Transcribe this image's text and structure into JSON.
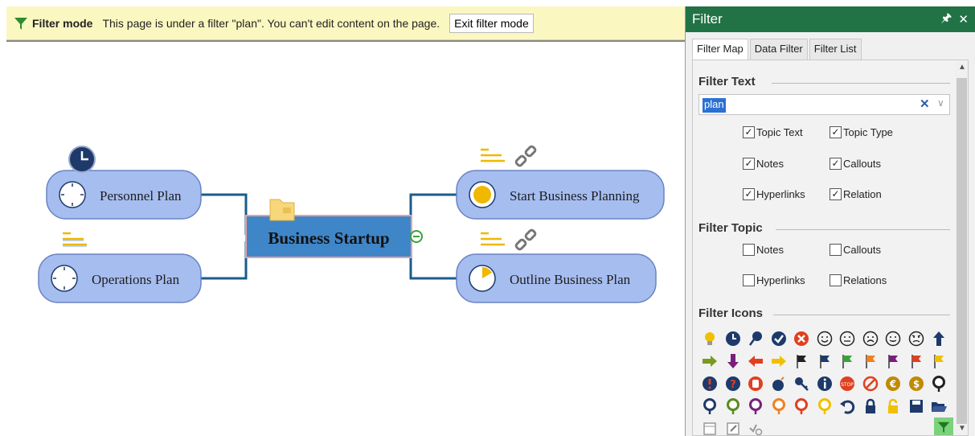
{
  "filterbar": {
    "title": "Filter mode",
    "message": "This page is under a filter \"plan\". You can't edit content on the page.",
    "exit_label": "Exit filter mode"
  },
  "mindmap": {
    "central": "Business Startup",
    "topics": {
      "personnel": "Personnel Plan",
      "operations": "Operations Plan",
      "start": "Start Business Planning",
      "outline": "Outline Business Plan"
    }
  },
  "panel": {
    "title": "Filter",
    "pin": "Ͱ",
    "close": "✕",
    "tabs": [
      "Filter Map",
      "Data Filter",
      "Filter List"
    ],
    "filter_text": {
      "title": "Filter Text",
      "value": "plan",
      "clear": "✕",
      "dropdown": "∨",
      "options": [
        "Topic Text",
        "Topic Type",
        "Notes",
        "Callouts",
        "Hyperlinks",
        "Relation"
      ]
    },
    "filter_topic": {
      "title": "Filter Topic",
      "options": [
        "Notes",
        "Callouts",
        "Hyperlinks",
        "Relations"
      ]
    },
    "filter_icons": {
      "title": "Filter Icons"
    }
  },
  "colors": {
    "accent_green": "#217346",
    "topic_fill": "#a6bdf0",
    "central_fill": "#3f86c8",
    "connector": "#1a5c8c",
    "bar_yellow": "#fbf7c0"
  },
  "icons": [
    "bulb-icon",
    "clock-icon",
    "pushpin-icon",
    "check-icon",
    "x-circle-icon",
    "smile-icon",
    "neutral-face-icon",
    "sad-face-icon",
    "tongue-face-icon",
    "angry-face-icon",
    "arrow-up-icon",
    "arrow-right-icon",
    "arrow-down-icon",
    "arrow-left-icon",
    "arrow-left-yellow-icon",
    "flag-black-icon",
    "flag-blue-icon",
    "flag-green-icon",
    "flag-orange-icon",
    "flag-purple-icon",
    "flag-red-icon",
    "flag-yellow-icon",
    "exclamation-icon",
    "question-icon",
    "hand-icon",
    "bomb-icon",
    "key-icon",
    "info-icon",
    "stop-icon",
    "prohibit-icon",
    "euro-icon",
    "dollar-icon",
    "pin-black-icon",
    "pin-blue-icon",
    "pin-green-icon",
    "pin-purple-icon",
    "pin-orange-icon",
    "pin-red-icon",
    "pin-yellow-icon",
    "undo-icon",
    "lock-icon",
    "unlock-icon",
    "save-icon",
    "open-folder-icon",
    "task-icon",
    "edit-icon",
    "link-icon"
  ]
}
